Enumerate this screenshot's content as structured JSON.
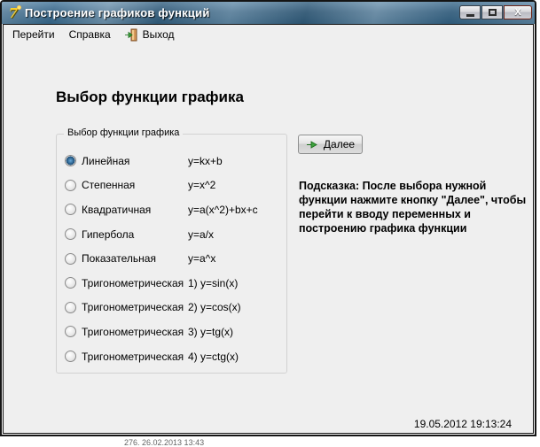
{
  "window": {
    "title": "Построение графиков функций"
  },
  "menu": {
    "items": [
      {
        "label": "Перейти"
      },
      {
        "label": "Справка"
      }
    ],
    "exit_label": "Выход"
  },
  "main": {
    "heading": "Выбор функции графика",
    "groupbox": {
      "title": "Выбор функции графика",
      "options": [
        {
          "label": "Линейная",
          "formula": "y=kx+b",
          "selected": true
        },
        {
          "label": "Степенная",
          "formula": "y=x^2",
          "selected": false
        },
        {
          "label": "Квадратичная",
          "formula": "y=a(x^2)+bx+c",
          "selected": false
        },
        {
          "label": "Гипербола",
          "formula": "y=a/x",
          "selected": false
        },
        {
          "label": "Показательная",
          "formula": "y=a^x",
          "selected": false
        },
        {
          "label": "Тригонометрическая",
          "formula": "1) y=sin(x)",
          "selected": false
        },
        {
          "label": "Тригонометрическая",
          "formula": "2) y=cos(x)",
          "selected": false
        },
        {
          "label": "Тригонометрическая",
          "formula": "3) y=tg(x)",
          "selected": false
        },
        {
          "label": "Тригонометрическая",
          "formula": "4) y=ctg(x)",
          "selected": false
        }
      ]
    },
    "next_button_label": "Далее",
    "hint": "Подсказка: После выбора нужной функции нажмите кнопку \"Далее\", чтобы перейти к вводу переменных и построению графика функции",
    "timestamp": "19.05.2012 19:13:24"
  },
  "background_fragment": "276. 26.02.2013 13:43",
  "colors": {
    "titlebar_blue": "#456f8e",
    "close_button_red": "#c65f45",
    "arrow_green": "#3da33d",
    "client_gray": "#efefef"
  }
}
